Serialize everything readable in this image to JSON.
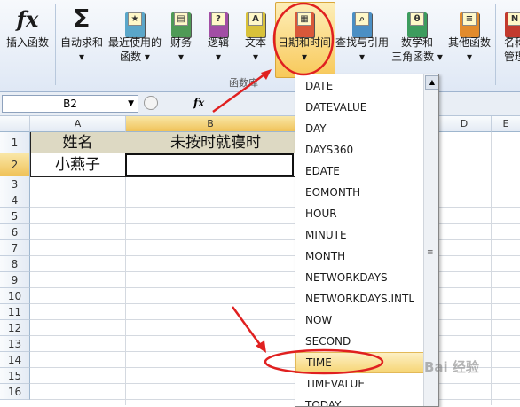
{
  "ribbon": {
    "buttons": [
      {
        "label": "插入函数",
        "icon": "fx-icon"
      },
      {
        "label": "自动求和\n▾",
        "icon": "sigma-icon"
      },
      {
        "label": "最近使用的\n函数 ▾",
        "icon": "star-book-icon"
      },
      {
        "label": "财务\n▾",
        "icon": "finance-book-icon"
      },
      {
        "label": "逻辑\n▾",
        "icon": "question-book-icon"
      },
      {
        "label": "文本\n▾",
        "icon": "text-book-icon"
      },
      {
        "label": "日期和时间\n▾",
        "icon": "calendar-book-icon"
      },
      {
        "label": "查找与引用\n▾",
        "icon": "lookup-book-icon"
      },
      {
        "label": "数学和\n三角函数 ▾",
        "icon": "theta-book-icon"
      },
      {
        "label": "其他函数\n▾",
        "icon": "other-book-icon"
      },
      {
        "label": "名称\n管理",
        "icon": "name-manager-icon"
      }
    ],
    "group_label": "函数库"
  },
  "formula_bar": {
    "name_box": "B2",
    "fx": "fx",
    "content": ""
  },
  "grid": {
    "columns": [
      "A",
      "B",
      "D",
      "E"
    ],
    "rows": [
      "1",
      "2",
      "3",
      "4",
      "5",
      "6",
      "7",
      "8",
      "9",
      "10",
      "11",
      "12",
      "13",
      "14",
      "15",
      "16"
    ],
    "cells": {
      "A1": "姓名",
      "B1": "未按时就寝时",
      "A2": "小燕子"
    }
  },
  "dropdown": {
    "items": [
      "DATE",
      "DATEVALUE",
      "DAY",
      "DAYS360",
      "EDATE",
      "EOMONTH",
      "HOUR",
      "MINUTE",
      "MONTH",
      "NETWORKDAYS",
      "NETWORKDAYS.INTL",
      "NOW",
      "SECOND",
      "TIME",
      "TIMEVALUE",
      "TODAY"
    ],
    "highlighted": "TIME"
  },
  "watermark": "Bai 经验",
  "colors": {
    "accent": "#f6d575",
    "annotation": "#e02020"
  }
}
